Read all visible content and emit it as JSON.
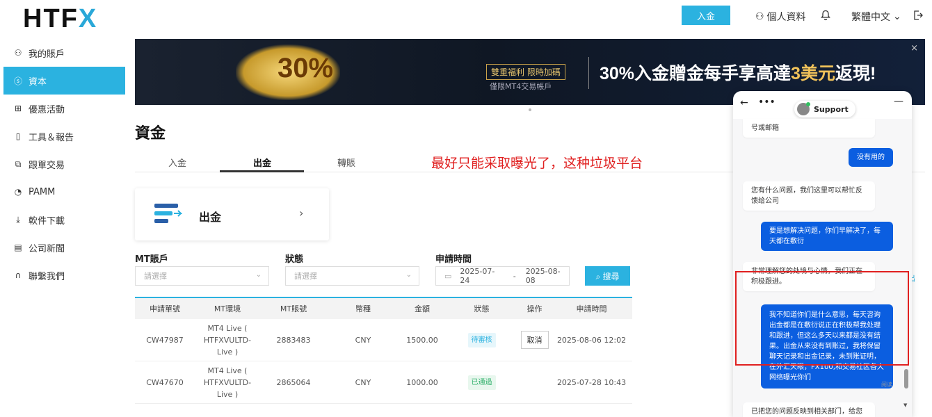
{
  "header": {
    "logo_text": "HTF",
    "logo_mark": "X",
    "deposit_label": "入金",
    "profile_label": "個人資料",
    "language_label": "繁體中文"
  },
  "sidebar": {
    "items": [
      {
        "label": "我的賬戶",
        "icon": "user-icon"
      },
      {
        "label": "資本",
        "icon": "dollar-icon",
        "active": true
      },
      {
        "label": "優惠活動",
        "icon": "gift-icon"
      },
      {
        "label": "工具＆報告",
        "icon": "book-icon"
      },
      {
        "label": "跟單交易",
        "icon": "copy-icon"
      },
      {
        "label": "PAMM",
        "icon": "pie-icon"
      },
      {
        "label": "軟件下載",
        "icon": "download-icon"
      },
      {
        "label": "公司新聞",
        "icon": "news-icon"
      },
      {
        "label": "聯繫我們",
        "icon": "headset-icon"
      }
    ]
  },
  "banner": {
    "percent": "30%",
    "tag1": "雙重福利 限時加碼",
    "tag2": "僅限MT4交易帳戶",
    "promo_a": "30%入金贈金每手享高達",
    "promo_b": "3美元",
    "promo_c": "返現!",
    "close": "×"
  },
  "main": {
    "title": "資金",
    "tabs": [
      "入金",
      "出金",
      "轉賬"
    ],
    "active_tab": 1,
    "red_note": "最好只能采取曝光了，这种垃圾平台",
    "card_label": "出金",
    "filters": {
      "mt_label": "MT賬戶",
      "mt_placeholder": "請選擇",
      "status_label": "狀態",
      "status_placeholder": "請選擇",
      "time_label": "申請時間",
      "date_from": "2025-07-24",
      "date_sep": "-",
      "date_to": "2025-08-08",
      "search_label": "搜尋"
    },
    "side_fragment": "出"
  },
  "table": {
    "headers": [
      "申請單號",
      "MT環境",
      "MT賬號",
      "幣種",
      "金額",
      "狀態",
      "操作",
      "申請時間"
    ],
    "rows": [
      {
        "id": "CW47987",
        "env1": "MT4 Live (",
        "env2": "HTFXVULTD-",
        "env3": "Live )",
        "account": "2883483",
        "currency": "CNY",
        "amount": "1500.00",
        "status": "待審核",
        "status_type": "pending",
        "action": "取消",
        "time": "2025-08-06 12:02"
      },
      {
        "id": "CW47670",
        "env1": "MT4 Live (",
        "env2": "HTFXVULTD-",
        "env3": "Live )",
        "account": "2865064",
        "currency": "CNY",
        "amount": "1000.00",
        "status": "已通過",
        "status_type": "done",
        "action": "",
        "time": "2025-07-28 10:43"
      }
    ]
  },
  "chat": {
    "title": "Support",
    "messages": [
      {
        "dir": "in",
        "text": "号或邮箱"
      },
      {
        "dir": "out",
        "text": "没有用的"
      },
      {
        "dir": "in",
        "text": "您有什么问题，我们这里可以帮忙反馈给公司"
      },
      {
        "dir": "out",
        "text": "要是想解决问题，你们早解决了，每天都在敷衍"
      },
      {
        "dir": "in",
        "text": "非常理解您的处境与心情，我们正在积极跟进。"
      },
      {
        "dir": "out",
        "text": "我不知道你们是什么意思，每天咨询出金都是在敷衍说正在积极帮我处理和跟进，但这么多天以来都是没有结果。出金从来没有到账过，我将保留聊天记录和出金记录，未到账证明，在外汇天眼，FX100,和交易社区各大网络曝光你们"
      },
      {
        "dir": "in",
        "text": "已把您的问题反映到相关部门，给您"
      }
    ],
    "read_label": "阅读"
  }
}
